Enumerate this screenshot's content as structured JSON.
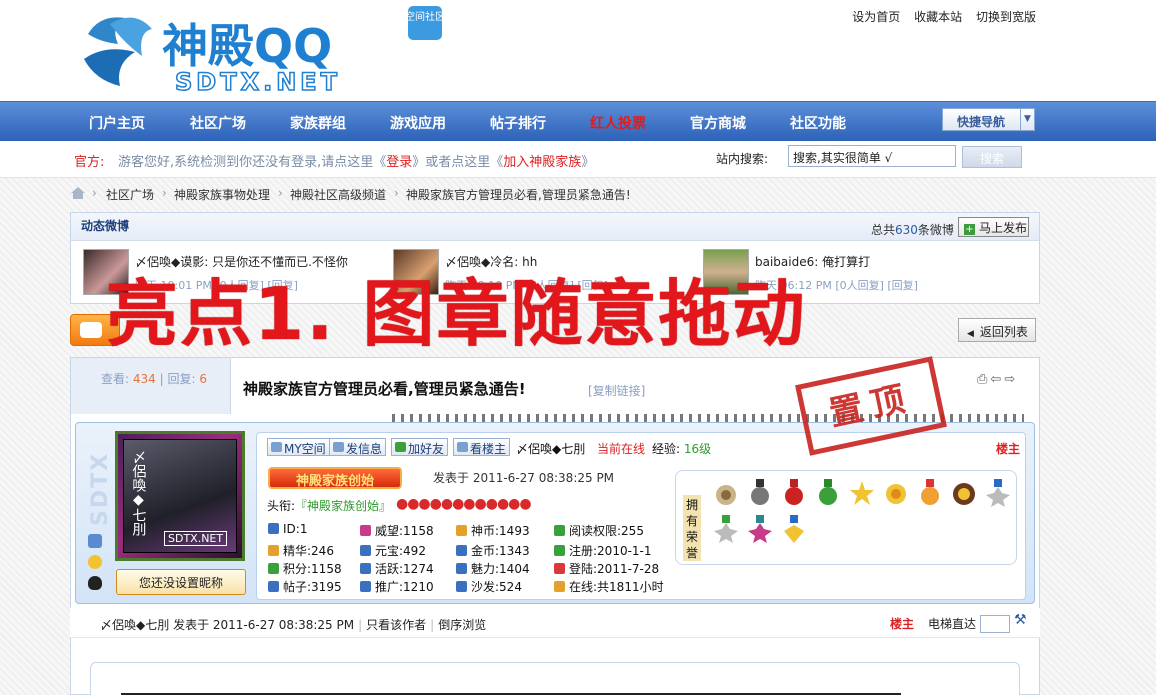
{
  "header": {
    "logo_text": "神殿QQ",
    "logo_sub": "SDTX.NET",
    "logo_badge": "空间社区",
    "top_links": [
      "设为首页",
      "收藏本站",
      "切换到宽版"
    ]
  },
  "nav": {
    "items": [
      {
        "label": "门户主页"
      },
      {
        "label": "社区广场"
      },
      {
        "label": "家族群组"
      },
      {
        "label": "游戏应用"
      },
      {
        "label": "帖子排行"
      },
      {
        "label": "红人投票",
        "highlight": true
      },
      {
        "label": "官方商城"
      },
      {
        "label": "社区功能"
      }
    ],
    "quick_nav": "快捷导航"
  },
  "notice": {
    "prefix": "官方:",
    "text_a": "游客您好,系统检测到你还没有登录,请点这里《",
    "login": "登录",
    "text_b": "》或者点这里《",
    "join": "加入神殿家族",
    "text_c": "》",
    "search_label": "站内搜索:",
    "search_value": "搜索,其实很简单 √",
    "search_button": "搜索"
  },
  "breadcrumb": [
    "社区广场",
    "神殿家族事物处理",
    "神殿社区高级频道",
    "神殿家族官方管理员必看,管理员紧急通告!"
  ],
  "weibo": {
    "title": "动态微博",
    "total_prefix": "总共",
    "total": "630",
    "total_suffix": "条微博",
    "publish": "马上发布",
    "entries": [
      {
        "text": "〆侶喚◆谟影: 只是你还不懂而已.不怪你",
        "meta": "昨天 10:01 PM [0人回复] [回复]"
      },
      {
        "text": "〆侶喚◆冷名: hh",
        "meta": "昨天 08:10 PM [0人回复] [回复]"
      },
      {
        "text": "baibaide6: 俺打算打",
        "meta": "昨天 06:12 PM [0人回复] [回复]"
      }
    ]
  },
  "overlay": {
    "banner": "亮点1. 图章随意拖动",
    "stamp": "置顶"
  },
  "post": {
    "back": "返回列表",
    "views_label": "查看:",
    "views": "434",
    "replies_label": "回复:",
    "replies": "6",
    "title": "神殿家族官方管理员必看,管理员紧急通告!",
    "copy_link": "[复制链接]"
  },
  "author": {
    "side_label": "SDTX",
    "avatar_text": "〆侶喚◆七刖",
    "avatar_tag": "SDTX.NET",
    "nickname_prompt": "您还没设置昵称",
    "buttons": [
      "MY空间",
      "发信息",
      "加好友",
      "看楼主"
    ],
    "name": "〆侶喚◆七刖",
    "status": "当前在线",
    "exp_label": "经验:",
    "exp_level": "16级",
    "floor": "楼主",
    "founder_badge": "神殿家族创始",
    "posted": "发表于 2011-6-27 08:38:25 PM",
    "head_label": "头衔:",
    "head_value": "『神殿家族创始』",
    "stats": [
      {
        "label": "ID:1",
        "color": "#3b6fc2"
      },
      {
        "label": "精华:246",
        "color": "#e3a02a"
      },
      {
        "label": "积分:1158",
        "color": "#3aa03a"
      },
      {
        "label": "帖子:3195",
        "color": "#3b6fc2"
      },
      {
        "label": "威望:1158",
        "color": "#c83a8a"
      },
      {
        "label": "元宝:492",
        "color": "#3b6fc2"
      },
      {
        "label": "活跃:1274",
        "color": "#3b6fc2"
      },
      {
        "label": "推广:1210",
        "color": "#3b6fc2"
      },
      {
        "label": "神币:1493",
        "color": "#e3a02a"
      },
      {
        "label": "金币:1343",
        "color": "#3b6fc2"
      },
      {
        "label": "魅力:1404",
        "color": "#3b6fc2"
      },
      {
        "label": "沙发:524",
        "color": "#3b6fc2"
      },
      {
        "label": "阅读权限:255",
        "color": "#3aa03a"
      },
      {
        "label": "注册:2010-1-1",
        "color": "#3aa03a"
      },
      {
        "label": "登陆:2011-7-28",
        "color": "#d83a3a"
      },
      {
        "label": "在线:共1811小时",
        "color": "#e3a02a"
      }
    ],
    "medals_label": "拥有荣誉"
  },
  "postmeta": {
    "author": "〆侶喚◆七刖",
    "posted": "发表于 2011-6-27 08:38:25 PM",
    "only_author": "只看该作者",
    "reverse": "倒序浏览",
    "floor": "楼主",
    "elevator": "电梯直达"
  },
  "colors": {
    "nav_blue": "#2c62b8",
    "accent_red": "#e1171b",
    "link_blue": "#2c5aa0"
  }
}
